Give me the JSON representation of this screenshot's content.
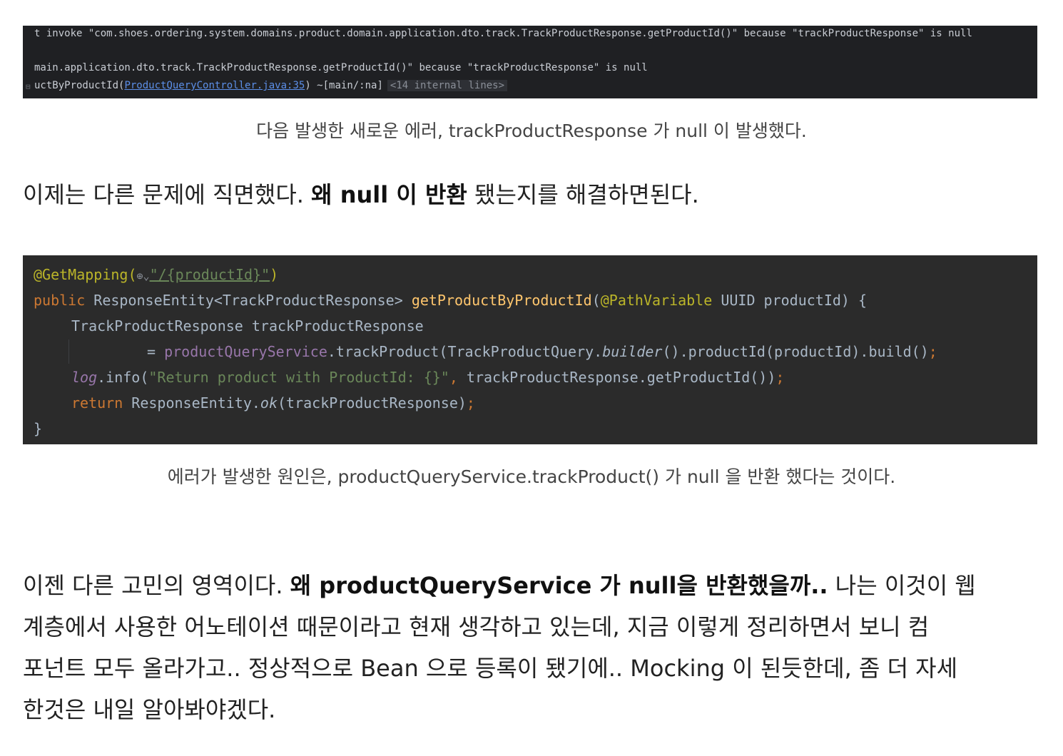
{
  "log": {
    "line1": "t invoke \"com.shoes.ordering.system.domains.product.domain.application.dto.track.TrackProductResponse.getProductId()\" because \"trackProductResponse\" is null",
    "line2": "main.application.dto.track.TrackProductResponse.getProductId()\" because \"trackProductResponse\" is null",
    "line3_prefix": "uctByProductId(",
    "line3_link": "ProductQueryController.java:35",
    "line3_suffix": ") ~[main/:na]",
    "internal_lines": "<14 internal lines>"
  },
  "caption1": "다음 발생한 새로운 에러, trackProductResponse 가 null 이 발생했다.",
  "para1": {
    "text_before": "이제는 다른 문제에 직면했다. ",
    "bold": "왜 null 이 반환",
    "text_after": " 됐는지를 해결하면된다."
  },
  "code": {
    "annotation": "@GetMapping(",
    "path": "\"/{productId}\"",
    "close_paren": ")",
    "l2_public": "public",
    "l2_type": " ResponseEntity<TrackProductResponse> ",
    "l2_method": "getProductByProductId",
    "l2_open": "(",
    "l2_annot": "@PathVariable",
    "l2_rest": " UUID productId) {",
    "l3": "TrackProductResponse trackProductResponse",
    "l4_eq": "= ",
    "l4_field": "productQueryService",
    "l4_call": ".trackProduct(TrackProductQuery.",
    "l4_builder": "builder",
    "l4_rest": "().productId(productId).build()",
    "l4_semi": ";",
    "l5_log": "log",
    "l5_info": ".info(",
    "l5_str": "\"Return product with ProductId: {}\"",
    "l5_comma": ", ",
    "l5_rest": "trackProductResponse.getProductId())",
    "l5_semi": ";",
    "l6_return": "return",
    "l6_type": " ResponseEntity.",
    "l6_ok": "ok",
    "l6_rest": "(trackProductResponse)",
    "l6_semi": ";",
    "l7": "}"
  },
  "caption2": "에러가 발생한 원인은, productQueryService.trackProduct() 가 null 을 반환 했다는 것이다.",
  "para2": {
    "text_before": "이젠 다른 고민의 영역이다. ",
    "bold": "왜 productQueryService 가 null을 반환했을까..",
    "line1_after": " 나는 이것이 웹",
    "line2": "계층에서 사용한 어노테이션 때문이라고 현재 생각하고 있는데, 지금 이렇게 정리하면서 보니 컴",
    "line3": "포넌트 모두 올라가고.. 정상적으로 Bean 으로 등록이 됐기에.. Mocking 이 된듯한데, 좀 더 자세",
    "line4": "한것은 내일 알아봐야겠다."
  }
}
